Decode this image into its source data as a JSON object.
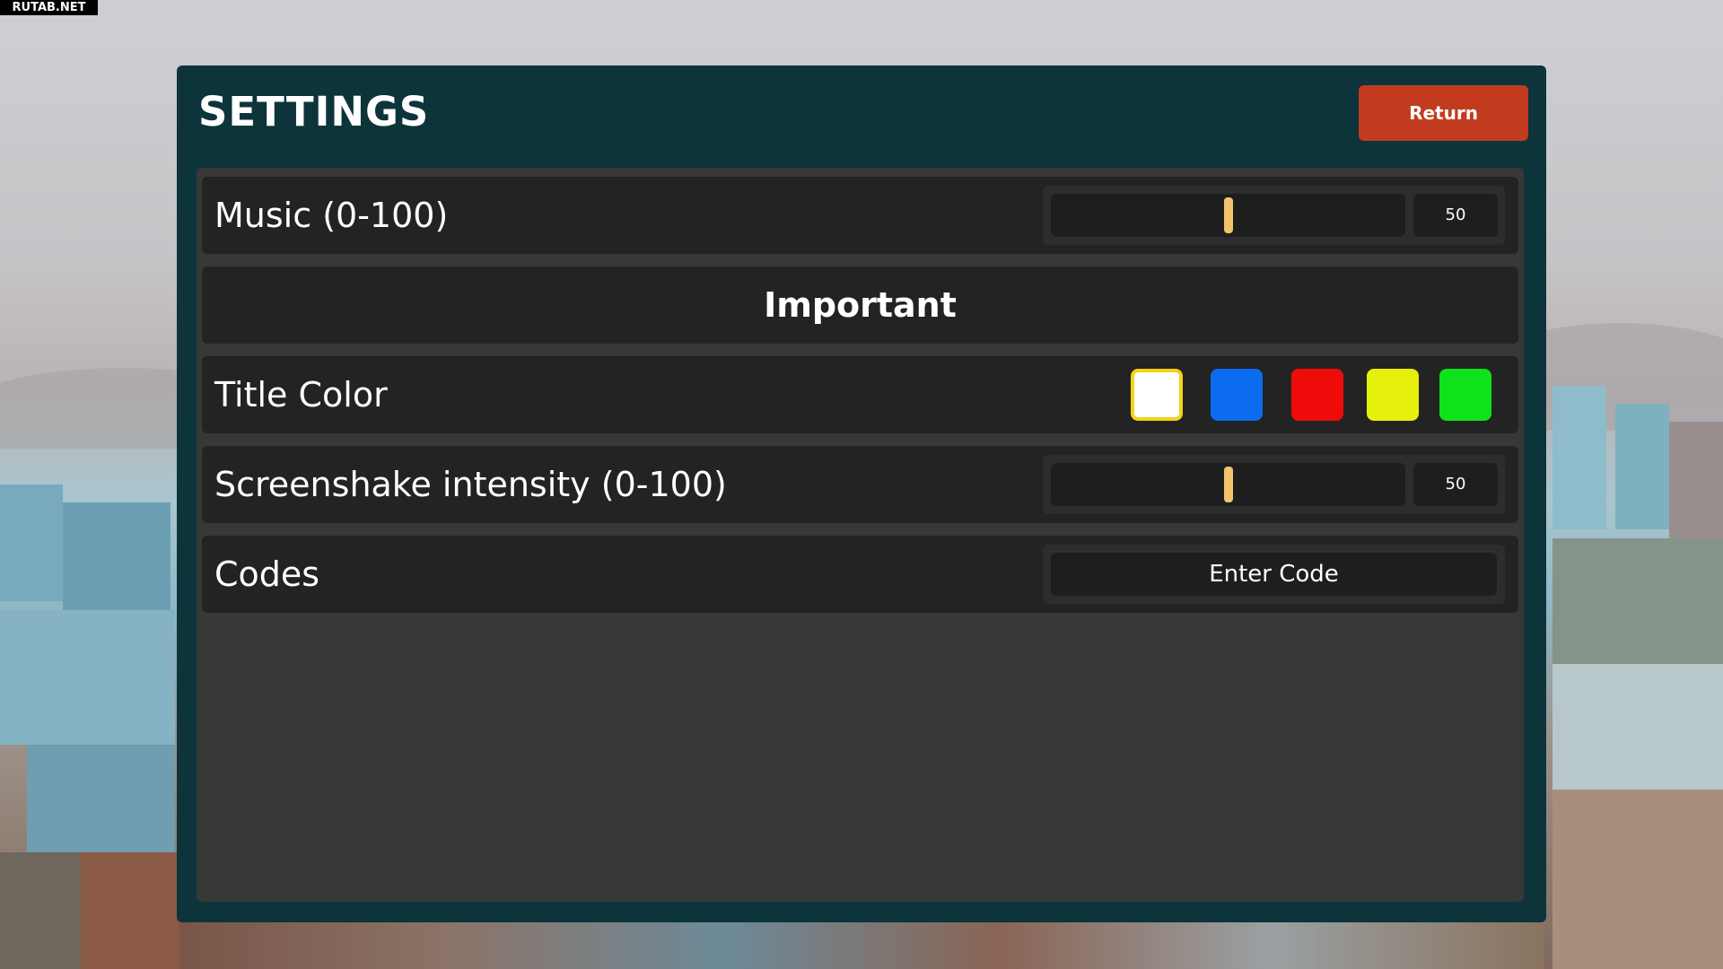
{
  "watermark": "RUTAB.NET",
  "settings": {
    "title": "SETTINGS",
    "return_label": "Return",
    "rows": {
      "music": {
        "label": "Music (0-100)",
        "value": "50",
        "level": 0.5
      },
      "important": {
        "label": "Important"
      },
      "title_color": {
        "label": "Title Color",
        "swatches": [
          {
            "name": "white",
            "color": "#ffffff",
            "selected": true
          },
          {
            "name": "blue",
            "color": "#0b6cf0",
            "selected": false
          },
          {
            "name": "red",
            "color": "#f00b0b",
            "selected": false
          },
          {
            "name": "yellow",
            "color": "#e5f00b",
            "selected": false
          },
          {
            "name": "green",
            "color": "#0fe21a",
            "selected": false
          }
        ]
      },
      "screenshake": {
        "label": "Screenshake intensity (0-100)",
        "value": "50",
        "level": 0.5
      },
      "codes": {
        "label": "Codes",
        "input_text": "Enter Code"
      }
    }
  },
  "colors": {
    "panel": "#0d343b",
    "content": "#383838",
    "row": "#232323",
    "return_button": "#c23b1e",
    "slider_thumb": "#f1c46b",
    "selected_outline": "#f2d318"
  }
}
